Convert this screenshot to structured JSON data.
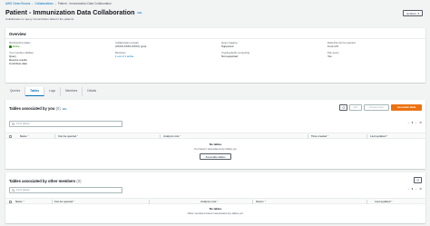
{
  "breadcrumb": {
    "items": [
      "AWS Clean Rooms",
      "Collaborations",
      "Patient - Immunization Data Collaboration"
    ]
  },
  "header": {
    "title": "Patient - Immunization Data Collaboration",
    "info": "Info",
    "description": "Collaboration to query immunization data for the patients",
    "actions_label": "Actions"
  },
  "overview": {
    "heading": "Overview",
    "columns": [
      {
        "fields": [
          {
            "label": "Membership status",
            "value": "Active",
            "type": "status"
          },
          {
            "label": "Your member abilities",
            "values": [
              "Query",
              "Receive results",
              "Contribute data"
            ]
          }
        ]
      },
      {
        "fields": [
          {
            "label": "Collaboration creator",
            "value": "(XXXX-XXXX-XXXX) (you)"
          },
          {
            "label": "Members",
            "value": "1 out of 1 active",
            "type": "link"
          }
        ]
      },
      {
        "fields": [
          {
            "label": "Query logging",
            "value": "Supported"
          },
          {
            "label": "Cryptographic computing",
            "value": "Not supported"
          }
        ]
      },
      {
        "fields": [
          {
            "label": "Data that can be queried",
            "value": "0 out of 0"
          },
          {
            "label": "Pay query",
            "value": "Yes"
          }
        ]
      }
    ]
  },
  "tabs": [
    "Queries",
    "Tables",
    "Logs",
    "Members",
    "Details"
  ],
  "active_tab": "Tables",
  "your_tables": {
    "heading": "Tables associated by you",
    "count": "(0)",
    "info": "Info",
    "buttons": {
      "edit": "Edit",
      "disassociate": "Disassociate",
      "associate": "Associate table"
    },
    "search_placeholder": "Find tables",
    "pager": {
      "page": "1"
    },
    "columns": [
      "Name",
      "Can be queried",
      "Analysis rule",
      "Time created",
      "Last updated"
    ],
    "empty_title": "No tables",
    "empty_desc": "You haven't associated any tables yet.",
    "empty_button": "Associate tables"
  },
  "other_tables": {
    "heading": "Tables associated by other members",
    "count": "(0)",
    "search_placeholder": "Find tables",
    "pager": {
      "page": "1"
    },
    "columns": [
      "Name",
      "Can be queried",
      "Analysis rule",
      "Owner",
      "Last updated"
    ],
    "empty_title": "No tables",
    "empty_desc": "Other members haven't associated any tables yet."
  },
  "colors": {
    "primary": "#ec7211",
    "link": "#0073bb",
    "success": "#1d8102",
    "background": "#f2f3f3"
  },
  "icons": {
    "external": "external-link-icon",
    "caret": "caret-down-icon",
    "refresh": "refresh-icon",
    "search": "search-icon",
    "settings": "gear-icon"
  }
}
